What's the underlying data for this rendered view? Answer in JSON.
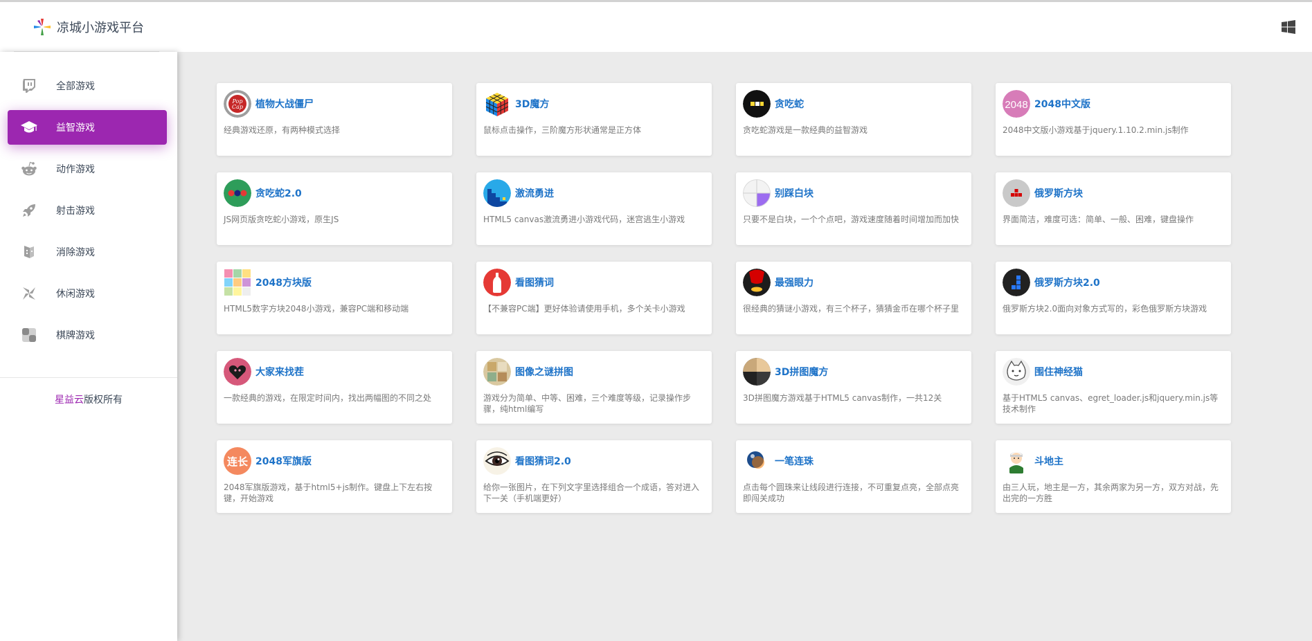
{
  "app": {
    "title": "凉城小游戏平台",
    "accent_color": "#9c27b0",
    "link_color": "#1e73c8"
  },
  "header": {
    "logo_icon": "pinwheel-logo-icon",
    "os_icon": "windows-icon"
  },
  "sidebar": {
    "items": [
      {
        "label": "全部游戏",
        "icon": "twitch-icon",
        "active": false
      },
      {
        "label": "益智游戏",
        "icon": "graduation-cap-icon",
        "active": true
      },
      {
        "label": "动作游戏",
        "icon": "reddit-icon",
        "active": false
      },
      {
        "label": "射击游戏",
        "icon": "rocket-icon",
        "active": false
      },
      {
        "label": "消除游戏",
        "icon": "dice-icon",
        "active": false
      },
      {
        "label": "休闲游戏",
        "icon": "pinwheel-icon",
        "active": false
      },
      {
        "label": "棋牌游戏",
        "icon": "checkerboard-icon",
        "active": false
      }
    ],
    "footer": {
      "brand": "星益云",
      "suffix": "版权所有"
    }
  },
  "games": [
    {
      "title": "植物大战僵尸",
      "desc": "经典游戏还原，有两种模式选择",
      "icon": "popcap-icon"
    },
    {
      "title": "3D魔方",
      "desc": "鼠标点击操作，三阶魔方形状通常是正方体",
      "icon": "rubiks-cube-icon"
    },
    {
      "title": "贪吃蛇",
      "desc": "贪吃蛇游戏是一款经典的益智游戏",
      "icon": "snake-icon"
    },
    {
      "title": "2048中文版",
      "desc": "2048中文版小游戏基于jquery.1.10.2.min.js制作",
      "icon": "icon-2048"
    },
    {
      "title": "贪吃蛇2.0",
      "desc": "JS网页版贪吃蛇小游戏，原生JS",
      "icon": "snake-dots-icon"
    },
    {
      "title": "激流勇进",
      "desc": "HTML5 canvas激流勇进小游戏代码，迷宫逃生小游戏",
      "icon": "stairs-icon"
    },
    {
      "title": "别踩白块",
      "desc": "只要不是白块，一个个点吧，游戏速度随着时间增加而加快",
      "icon": "piano-tiles-icon"
    },
    {
      "title": "俄罗斯方块",
      "desc": "界面简洁，难度可选：简单、一般、困难，键盘操作",
      "icon": "tetris-icon"
    },
    {
      "title": "2048方块版",
      "desc": "HTML5数字方块2048小游戏，兼容PC端和移动端",
      "icon": "tile-grid-icon"
    },
    {
      "title": "看图猜词",
      "desc": "【不兼容PC端】更好体验请使用手机，多个关卡小游戏",
      "icon": "bottle-icon"
    },
    {
      "title": "最强眼力",
      "desc": "很经典的猜谜小游戏，有三个杯子，猜猜金币在哪个杯子里",
      "icon": "cup-coin-icon"
    },
    {
      "title": "俄罗斯方块2.0",
      "desc": "俄罗斯方块2.0面向对象方式写的，彩色俄罗斯方块游戏",
      "icon": "tetris-blue-icon"
    },
    {
      "title": "大家来找茬",
      "desc": "一款经典的游戏，在限定时间内，找出两幅图的不同之处",
      "icon": "heart-icon"
    },
    {
      "title": "图像之谜拼图",
      "desc": "游戏分为简单、中等、困难，三个难度等级，记录操作步骤，纯html编写",
      "icon": "puzzle-photo-icon"
    },
    {
      "title": "3D拼图魔方",
      "desc": "3D拼图魔方游戏基于HTML5 canvas制作，一共12关",
      "icon": "puzzle-cube-icon"
    },
    {
      "title": "围住神经猫",
      "desc": "基于HTML5 canvas、egret_loader.js和jquery.min.js等技术制作",
      "icon": "cat-icon"
    },
    {
      "title": "2048军旗版",
      "desc": "2048军旗版游戏，基于html5+js制作。键盘上下左右按键，开始游戏",
      "icon": "army-flag-icon",
      "badge": "连长"
    },
    {
      "title": "看图猜词2.0",
      "desc": "给你一张图片，在下列文字里选择组合一个成语，答对进入下一关（手机端更好）",
      "icon": "eye-icon"
    },
    {
      "title": "一笔连珠",
      "desc": "点击每个圆珠来让线段进行连接，不可重复点亮，全部点亮即闯关成功",
      "icon": "ball-icon"
    },
    {
      "title": "斗地主",
      "desc": "由三人玩，地主是一方，其余两家为另一方，双方对战，先出完的一方胜",
      "icon": "landlord-icon"
    }
  ]
}
